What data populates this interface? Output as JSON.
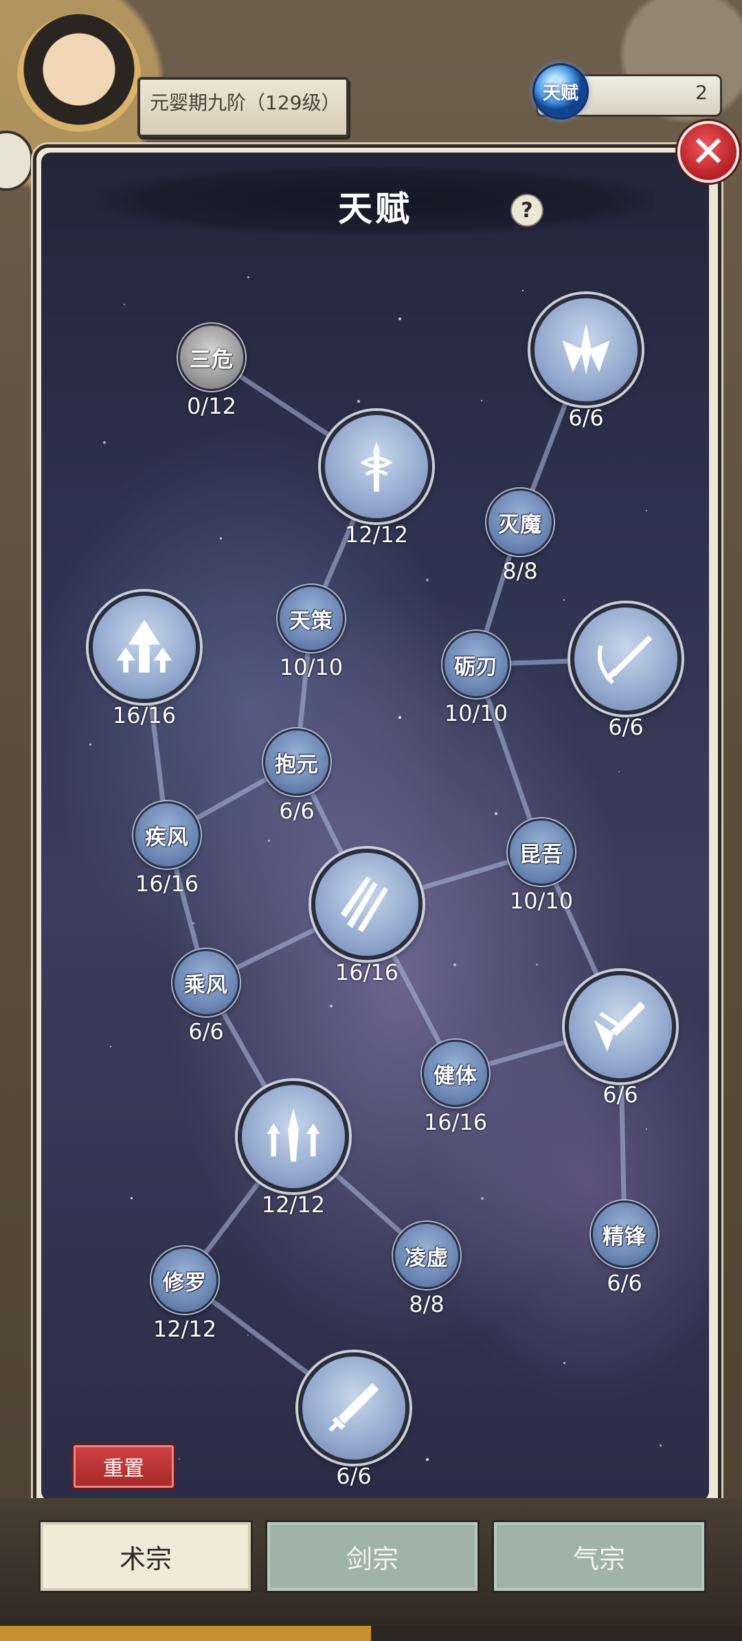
{
  "hud": {
    "rank_label": "元婴期九阶（129级）",
    "talent_orb_label": "天赋",
    "talent_points": "2"
  },
  "panel": {
    "title": "天赋",
    "help_label": "?",
    "reset_label": "重置"
  },
  "nodes": [
    {
      "id": "sanwei",
      "name": "三危",
      "level": "0/12",
      "size": "small",
      "locked": true,
      "icon": ""
    },
    {
      "id": "top-center",
      "name": "",
      "level": "12/12",
      "size": "big",
      "locked": false,
      "icon": "caduceus-sword-icon"
    },
    {
      "id": "top-right",
      "name": "",
      "level": "6/6",
      "size": "big",
      "locked": false,
      "icon": "triple-blade-icon"
    },
    {
      "id": "miemo",
      "name": "灭魔",
      "level": "8/8",
      "size": "small",
      "locked": false,
      "icon": ""
    },
    {
      "id": "tiance",
      "name": "天策",
      "level": "10/10",
      "size": "small",
      "locked": false,
      "icon": ""
    },
    {
      "id": "left-big",
      "name": "",
      "level": "16/16",
      "size": "big",
      "locked": false,
      "icon": "arrow-tree-icon"
    },
    {
      "id": "liren",
      "name": "砺刃",
      "level": "10/10",
      "size": "small",
      "locked": false,
      "icon": ""
    },
    {
      "id": "right-sword",
      "name": "",
      "level": "6/6",
      "size": "big",
      "locked": false,
      "icon": "sword-slash-icon"
    },
    {
      "id": "baoyuan",
      "name": "抱元",
      "level": "6/6",
      "size": "small",
      "locked": false,
      "icon": ""
    },
    {
      "id": "jifeng",
      "name": "疾风",
      "level": "16/16",
      "size": "small",
      "locked": false,
      "icon": ""
    },
    {
      "id": "kunwu",
      "name": "昆吾",
      "level": "10/10",
      "size": "small",
      "locked": false,
      "icon": ""
    },
    {
      "id": "center-big",
      "name": "",
      "level": "16/16",
      "size": "big",
      "locked": false,
      "icon": "triple-sword-icon"
    },
    {
      "id": "chengfeng",
      "name": "乘风",
      "level": "6/6",
      "size": "small",
      "locked": false,
      "icon": ""
    },
    {
      "id": "right-broken",
      "name": "",
      "level": "6/6",
      "size": "big",
      "locked": false,
      "icon": "broken-sword-icon"
    },
    {
      "id": "jianti",
      "name": "健体",
      "level": "16/16",
      "size": "small",
      "locked": false,
      "icon": ""
    },
    {
      "id": "lower-big",
      "name": "",
      "level": "12/12",
      "size": "big",
      "locked": false,
      "icon": "sword-arrows-icon"
    },
    {
      "id": "jingfeng",
      "name": "精锋",
      "level": "6/6",
      "size": "small",
      "locked": false,
      "icon": ""
    },
    {
      "id": "lingxu",
      "name": "凌虚",
      "level": "8/8",
      "size": "small",
      "locked": false,
      "icon": ""
    },
    {
      "id": "xiuluo",
      "name": "修罗",
      "level": "12/12",
      "size": "small",
      "locked": false,
      "icon": ""
    },
    {
      "id": "bottom-big",
      "name": "",
      "level": "6/6",
      "size": "big",
      "locked": false,
      "icon": "single-sword-icon"
    }
  ],
  "tabs": [
    {
      "label": "术宗",
      "active": true
    },
    {
      "label": "剑宗",
      "active": false
    },
    {
      "label": "气宗",
      "active": false
    }
  ],
  "colors": {
    "close_red": "#c8262e",
    "reset_red": "#b92f2f",
    "tab_active": "#f1ead8",
    "tab_inactive": "#9fb3a8",
    "node_blue": "#96acd0"
  }
}
